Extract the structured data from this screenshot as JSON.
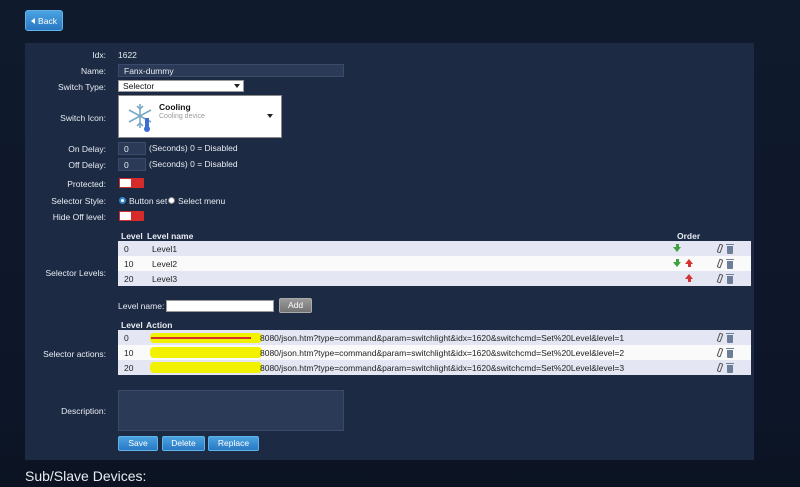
{
  "back_label": "Back",
  "form": {
    "idx_label": "Idx:",
    "idx_value": "1622",
    "name_label": "Name:",
    "name_value": "Fanx-dummy",
    "switch_type_label": "Switch Type:",
    "switch_type_value": "Selector",
    "switch_icon_label": "Switch Icon:",
    "icon_title": "Cooling",
    "icon_subtitle": "Cooling device",
    "on_delay_label": "On Delay:",
    "on_delay_value": "0",
    "on_delay_hint": "(Seconds) 0 = Disabled",
    "off_delay_label": "Off Delay:",
    "off_delay_value": "0",
    "off_delay_hint": "(Seconds) 0 = Disabled",
    "protected_label": "Protected:",
    "selector_style_label": "Selector Style:",
    "style_option_1": "Button set",
    "style_option_2": "Select menu",
    "hide_off_label": "Hide Off level:",
    "selector_levels_label": "Selector Levels:",
    "levels_header": {
      "level": "Level",
      "name": "Level name",
      "order": "Order"
    },
    "levels": [
      {
        "level": "0",
        "name": "Level1"
      },
      {
        "level": "10",
        "name": "Level2"
      },
      {
        "level": "20",
        "name": "Level3"
      }
    ],
    "level_name_label": "Level name:",
    "add_label": "Add",
    "selector_actions_label": "Selector actions:",
    "actions_header": {
      "level": "Level",
      "action": "Action"
    },
    "actions": [
      {
        "level": "0",
        "action": "8080/json.htm?type=command&param=switchlight&idx=1620&switchcmd=Set%20Level&level=1"
      },
      {
        "level": "10",
        "action": "8080/json.htm?type=command&param=switchlight&idx=1620&switchcmd=Set%20Level&level=2"
      },
      {
        "level": "20",
        "action": "8080/json.htm?type=command&param=switchlight&idx=1620&switchcmd=Set%20Level&level=3"
      }
    ],
    "description_label": "Description:",
    "save_label": "Save",
    "delete_label": "Delete",
    "replace_label": "Replace"
  },
  "sub_devices_title": "Sub/Slave Devices:",
  "colors": {
    "panel": "#1c2a44",
    "accent": "#2f86d0",
    "toggle": "#d62b2b"
  }
}
